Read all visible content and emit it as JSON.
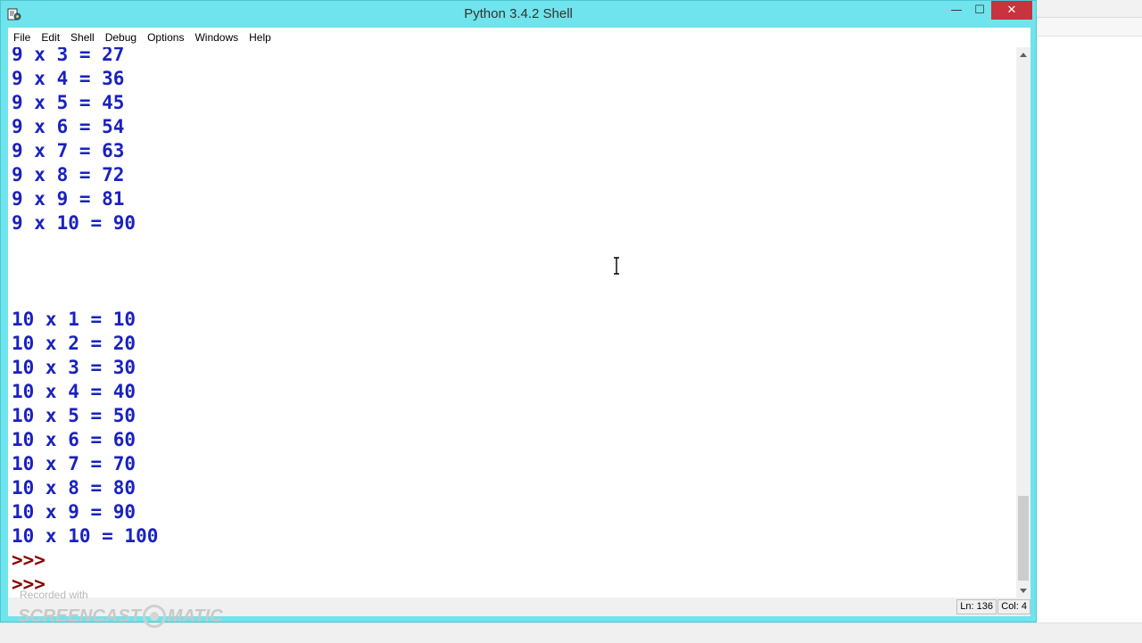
{
  "window": {
    "title": "Python 3.4.2 Shell",
    "min_glyph": "—",
    "max_glyph": "☐",
    "close_glyph": "✕"
  },
  "menu": {
    "items": [
      {
        "label": "File"
      },
      {
        "label": "Edit"
      },
      {
        "label": "Shell"
      },
      {
        "label": "Debug"
      },
      {
        "label": "Options"
      },
      {
        "label": "Windows"
      },
      {
        "label": "Help"
      }
    ]
  },
  "shell": {
    "lines": [
      {
        "text": "9 x 3 = 27",
        "kind": "output"
      },
      {
        "text": "9 x 4 = 36",
        "kind": "output"
      },
      {
        "text": "9 x 5 = 45",
        "kind": "output"
      },
      {
        "text": "9 x 6 = 54",
        "kind": "output"
      },
      {
        "text": "9 x 7 = 63",
        "kind": "output"
      },
      {
        "text": "9 x 8 = 72",
        "kind": "output"
      },
      {
        "text": "9 x 9 = 81",
        "kind": "output"
      },
      {
        "text": "9 x 10 = 90",
        "kind": "output"
      },
      {
        "text": "",
        "kind": "output"
      },
      {
        "text": "",
        "kind": "output"
      },
      {
        "text": "",
        "kind": "output"
      },
      {
        "text": "10 x 1 = 10",
        "kind": "output"
      },
      {
        "text": "10 x 2 = 20",
        "kind": "output"
      },
      {
        "text": "10 x 3 = 30",
        "kind": "output"
      },
      {
        "text": "10 x 4 = 40",
        "kind": "output"
      },
      {
        "text": "10 x 5 = 50",
        "kind": "output"
      },
      {
        "text": "10 x 6 = 60",
        "kind": "output"
      },
      {
        "text": "10 x 7 = 70",
        "kind": "output"
      },
      {
        "text": "10 x 8 = 80",
        "kind": "output"
      },
      {
        "text": "10 x 9 = 90",
        "kind": "output"
      },
      {
        "text": "10 x 10 = 100",
        "kind": "output"
      },
      {
        "text": ">>>",
        "kind": "prompt"
      },
      {
        "text": ">>>",
        "kind": "prompt"
      }
    ]
  },
  "status": {
    "ln": "Ln: 136",
    "col": "Col: 4"
  },
  "watermark": {
    "small": "Recorded with",
    "left": "SCREENCAST",
    "right": "MATIC"
  },
  "colors": {
    "window_frame": "#6fe4ec",
    "output_text": "#1a22bf",
    "prompt_text": "#8b0000",
    "close_button": "#c7333f"
  },
  "icons": {
    "app": "python-idle-icon",
    "cursor": "text-ibeam-cursor",
    "scroll_up": "arrow-up-icon",
    "scroll_down": "arrow-down-icon"
  }
}
